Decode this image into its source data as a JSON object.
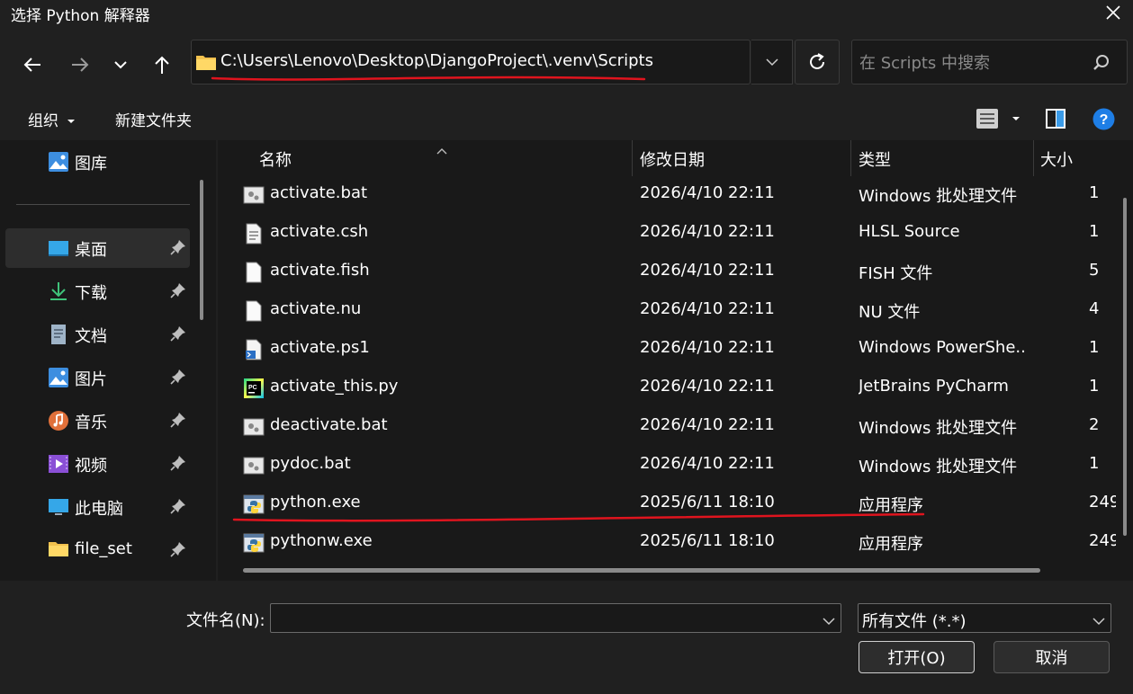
{
  "window": {
    "title": "选择 Python 解释器"
  },
  "address": {
    "path": "C:\\Users\\Lenovo\\Desktop\\DjangoProject\\.venv\\Scripts"
  },
  "search": {
    "placeholder": "在 Scripts 中搜索"
  },
  "toolbar": {
    "organize": "组织",
    "new_folder": "新建文件夹"
  },
  "sidebar": {
    "top_item": {
      "label": "图库",
      "icon": "gallery-icon"
    },
    "items": [
      {
        "label": "桌面",
        "icon": "desktop-icon",
        "pinned": true,
        "active": true
      },
      {
        "label": "下载",
        "icon": "download-icon",
        "pinned": true
      },
      {
        "label": "文档",
        "icon": "document-icon",
        "pinned": true
      },
      {
        "label": "图片",
        "icon": "pictures-icon",
        "pinned": true
      },
      {
        "label": "音乐",
        "icon": "music-icon",
        "pinned": true
      },
      {
        "label": "视频",
        "icon": "video-icon",
        "pinned": true
      },
      {
        "label": "此电脑",
        "icon": "computer-icon",
        "pinned": true
      },
      {
        "label": "file_set",
        "icon": "folder-icon",
        "pinned": true
      }
    ]
  },
  "columns": {
    "name": "名称",
    "modified": "修改日期",
    "type": "类型",
    "size": "大小"
  },
  "files": [
    {
      "name": "activate.bat",
      "modified": "2026/4/10 22:11",
      "type": "Windows 批处理文件",
      "size": "1",
      "icon": "batch-file-icon"
    },
    {
      "name": "activate.csh",
      "modified": "2026/4/10 22:11",
      "type": "HLSL Source",
      "size": "1",
      "icon": "text-file-icon"
    },
    {
      "name": "activate.fish",
      "modified": "2026/4/10 22:11",
      "type": "FISH 文件",
      "size": "5",
      "icon": "blank-file-icon"
    },
    {
      "name": "activate.nu",
      "modified": "2026/4/10 22:11",
      "type": "NU 文件",
      "size": "4",
      "icon": "blank-file-icon"
    },
    {
      "name": "activate.ps1",
      "modified": "2026/4/10 22:11",
      "type": "Windows PowerShe...",
      "size": "1",
      "icon": "powershell-file-icon"
    },
    {
      "name": "activate_this.py",
      "modified": "2026/4/10 22:11",
      "type": "JetBrains PyCharm",
      "size": "1",
      "icon": "pycharm-file-icon"
    },
    {
      "name": "deactivate.bat",
      "modified": "2026/4/10 22:11",
      "type": "Windows 批处理文件",
      "size": "2",
      "icon": "batch-file-icon"
    },
    {
      "name": "pydoc.bat",
      "modified": "2026/4/10 22:11",
      "type": "Windows 批处理文件",
      "size": "1",
      "icon": "batch-file-icon"
    },
    {
      "name": "python.exe",
      "modified": "2025/6/11 18:10",
      "type": "应用程序",
      "size": "249",
      "icon": "python-exe-icon"
    },
    {
      "name": "pythonw.exe",
      "modified": "2025/6/11 18:10",
      "type": "应用程序",
      "size": "249",
      "icon": "python-exe-icon"
    }
  ],
  "bottom": {
    "filename_label": "文件名(N):",
    "filename_value": "",
    "filetype_selected": "所有文件 (*.*)",
    "open_button": "打开(O)",
    "cancel_button": "取消"
  },
  "colors": {
    "annotation": "#e0141e",
    "background": "#202020",
    "pane": "#191919"
  }
}
